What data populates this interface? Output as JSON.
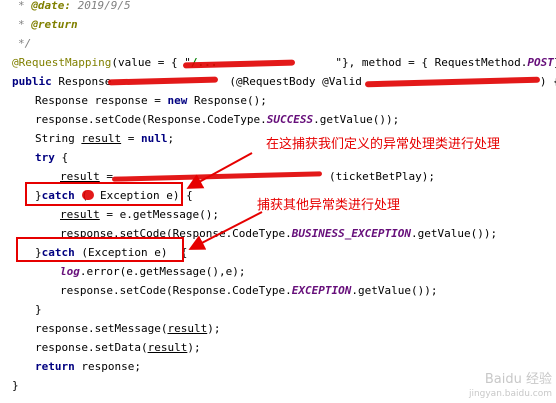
{
  "code": {
    "javadoc_date_tag": "@date:",
    "javadoc_date_value": "2019/9/5",
    "javadoc_return_tag": "@return",
    "javadoc_prefix": "*",
    "javadoc_end": "*/",
    "mapping_annotation": "@RequestMapping",
    "mapping_value_open": "(value = { \"",
    "mapping_path": "/...",
    "mapping_value_close": "\"}, method = { RequestMethod.",
    "mapping_method": "POST",
    "mapping_end": "})",
    "signature_kw": "public",
    "signature_type": "Response",
    "signature_param_annotation": "(@RequestBody @Valid",
    "signature_end": ") {",
    "decl_response_type": "Response response =",
    "decl_response_new": "new",
    "decl_response_ctor": "Response();",
    "set_code_success_pre": "response.setCode(Response.CodeType.",
    "set_code_success_const": "SUCCESS",
    "set_code_success_post": ".getValue());",
    "decl_result_type": "String",
    "decl_result_var": "result",
    "decl_result_eq": "=",
    "decl_result_null": "null",
    "decl_result_end": ";",
    "try_kw": "try",
    "try_brace": "{",
    "assign_result_var": "result",
    "assign_result_eq": "=",
    "assign_result_call_end": "(ticketBetPlay);",
    "catch1_close": "}",
    "catch1_kw": "catch",
    "catch1_open": "(",
    "catch1_type": "Exception e) {",
    "catch1_result_var": "result",
    "catch1_result_rest": "= e.getMessage();",
    "set_code_business_pre": "response.setCode(Response.CodeType.",
    "set_code_business_const": "BUSINESS_EXCEPTION",
    "set_code_business_post": ".getValue());",
    "catch2_close": "}",
    "catch2_kw": "catch",
    "catch2_rest": "(Exception e)  {",
    "log_var": "log",
    "log_rest": ".error(e.getMessage(),e);",
    "set_code_exception_pre": "response.setCode(Response.CodeType.",
    "set_code_exception_const": "EXCEPTION",
    "set_code_exception_post": ".getValue());",
    "close_brace": "}",
    "set_message_pre": "response.setMessage(",
    "set_message_var": "result",
    "set_message_post": ");",
    "set_data_pre": "response.setData(",
    "set_data_var": "result",
    "set_data_post": ");",
    "return_kw": "return",
    "return_rest": "response;",
    "method_close": "}"
  },
  "annotations": {
    "note_custom_exception": "在这捕获我们定义的异常处理类进行处理",
    "note_other_exception": "捕获其他异常类进行处理"
  },
  "watermark": {
    "brand": "Baidu 经验",
    "site": "jingyan.baidu.com"
  },
  "colors": {
    "keyword": "#000080",
    "annotation": "#808000",
    "string": "#008000",
    "static_field": "#660e7a",
    "comment": "#808080",
    "highlight_red": "#e60000"
  }
}
